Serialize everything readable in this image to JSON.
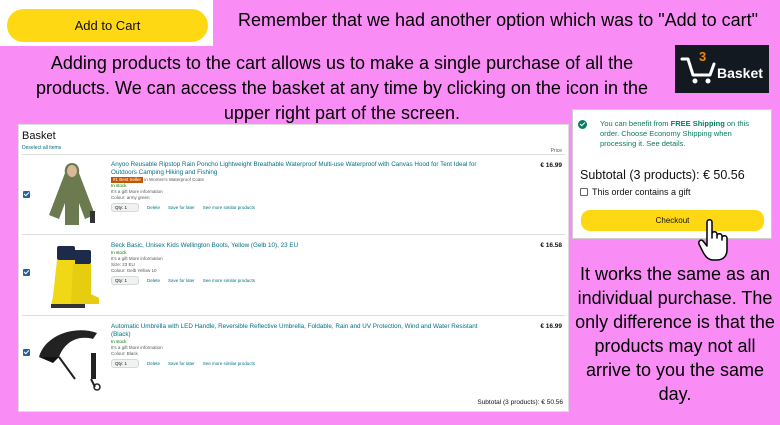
{
  "add_to_cart_button": "Add to Cart",
  "headline": "Remember that we had another option which was to \"Add to cart\"",
  "intro": "Adding products to the cart allows us to make a single purchase of all the products. We can access the basket at any time by clicking on the icon in the upper right part of the screen.",
  "basket_icon": {
    "count": "3",
    "label": "Basket",
    "icon": "cart-icon",
    "bg": "#131921",
    "count_color": "#f08804"
  },
  "basket": {
    "title": "Basket",
    "deselect": "Deselect all items",
    "price_header": "Price",
    "items": [
      {
        "title": "Anyoo Reusable Ripstop Rain Poncho Lightweight Breathable Waterproof Multi-use Waterproof with Canvas Hood for Tent Ideal for Outdoors Camping Hiking and Fishing",
        "badge": "#1 Best Seller",
        "badge_context": "in Women's Waterproof Coats",
        "stock": "In stock",
        "gift": "It's a gift More information",
        "detail": "Colour: army green",
        "price": "€ 16.99",
        "qty": "Qty: 1",
        "delete": "Delete",
        "save": "Save for later",
        "similar": "See more similar products"
      },
      {
        "title": "Beck Basic, Unisex Kids Wellington Boots, Yellow (Gelb 10), 23 EU",
        "stock": "In stock",
        "gift": "It's a gift More information",
        "detail": "Size: 23 EU",
        "detail2": "Colour: Gelb Yellow 10",
        "price": "€ 16.58",
        "qty": "Qty: 1",
        "delete": "Delete",
        "save": "Save for later",
        "similar": "See more similar products"
      },
      {
        "title": "Automatic Umbrella with LED Handle, Reversible Reflective Umbrella, Foldable, Rain and UV Protection, Wind and Water Resistant (Black)",
        "stock": "In stock",
        "gift": "It's a gift More information",
        "detail": "Colour: Black",
        "price": "€ 16.99",
        "qty": "Qty: 1",
        "delete": "Delete",
        "save": "Save for later",
        "similar": "See more similar products"
      }
    ],
    "subtotal": "Subtotal (3 products): € 50.56"
  },
  "checkout": {
    "ship_pre": "You can benefit from",
    "ship_bold": "FREE Shipping",
    "ship_post": "on this order. Choose Economy Shipping when processing it. See details.",
    "subtotal": "Subtotal (3 products): € 50.56",
    "gift": "This order contains a gift",
    "button": "Checkout"
  },
  "explanation": "It works the same as an individual purchase. The only difference is that the products may not all arrive to you the same day.",
  "colors": {
    "background": "#f98cf5",
    "button_yellow": "#ffd814",
    "link": "#007185"
  }
}
